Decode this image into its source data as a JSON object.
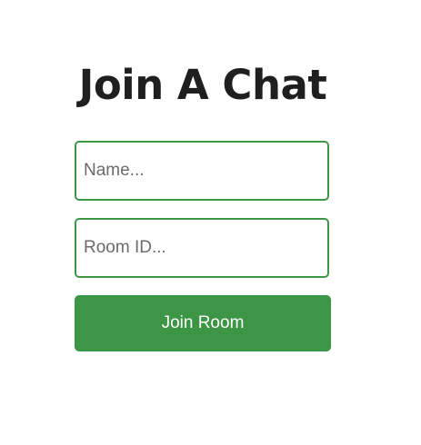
{
  "title": "Join A Chat",
  "form": {
    "name_placeholder": "Name...",
    "name_value": "",
    "room_placeholder": "Room ID...",
    "room_value": "",
    "join_label": "Join Room"
  },
  "colors": {
    "accent": "#3d9546",
    "title_text": "#1f1f1f",
    "background": "#ffffff"
  }
}
